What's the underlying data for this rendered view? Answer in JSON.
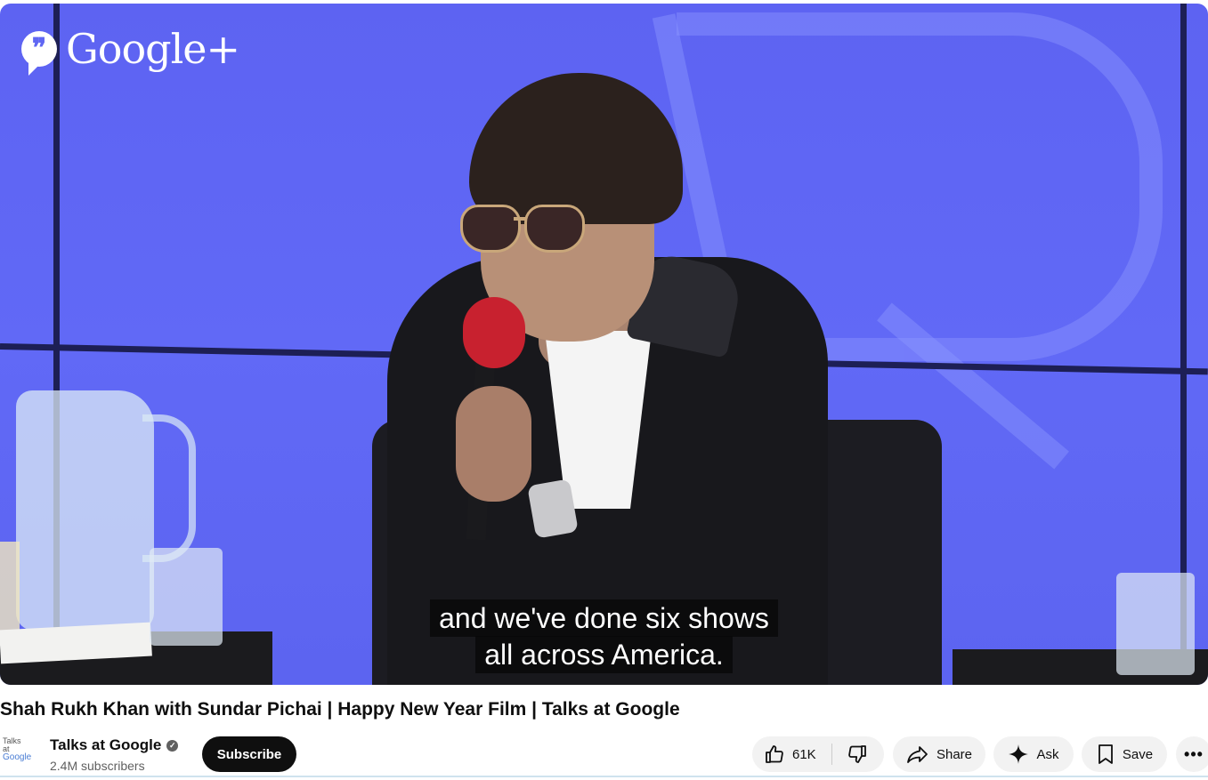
{
  "video": {
    "overlay_logo_text": "Google+",
    "caption_lines": [
      "and we've done six shows",
      "all across America."
    ]
  },
  "title": "Shah Rukh Khan with Sundar Pichai | Happy New Year Film | Talks at Google",
  "channel": {
    "avatar_text": [
      "Talks",
      "at",
      "Google"
    ],
    "name": "Talks at Google",
    "verified_icon": "verified-check-icon",
    "subscribers": "2.4M subscribers",
    "subscribe_label": "Subscribe"
  },
  "actions": {
    "like_count": "61K",
    "like_icon": "thumb-up-icon",
    "dislike_icon": "thumb-down-icon",
    "share_label": "Share",
    "share_icon": "share-arrow-icon",
    "ask_label": "Ask",
    "ask_icon": "sparkle-icon",
    "save_label": "Save",
    "save_icon": "bookmark-icon",
    "more_label": "•••"
  },
  "colors": {
    "subscribe_bg": "#0f0f0f",
    "pill_bg": "#f2f2f2",
    "player_bg": "#6169f6"
  }
}
